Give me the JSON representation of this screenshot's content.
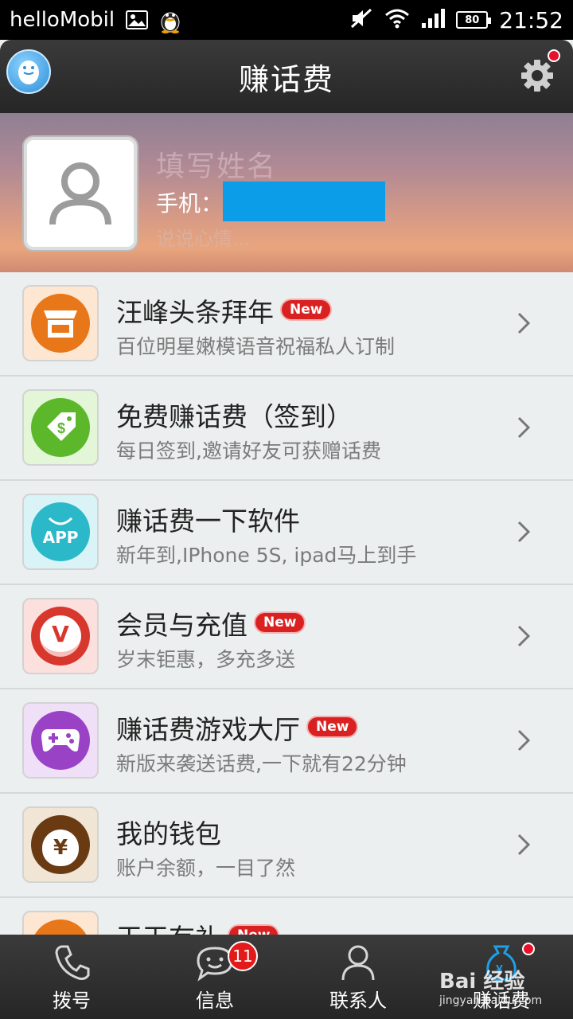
{
  "status_bar": {
    "carrier": "helloMobil",
    "battery": "80",
    "time": "21:52"
  },
  "header": {
    "title": "赚话费"
  },
  "profile": {
    "name_placeholder": "填写姓名",
    "phone_label": "手机：",
    "mood_placeholder": "说说心情..."
  },
  "menu": [
    {
      "title": "汪峰头条拜年",
      "subtitle": "百位明星嫩模语音祝福私人订制",
      "new": "New",
      "icon": "store-icon",
      "color": "#e8771a"
    },
    {
      "title": "免费赚话费（签到）",
      "subtitle": "每日签到,邀请好友可获赠话费",
      "new": "",
      "icon": "price-tag-icon",
      "color": "#5cb82a"
    },
    {
      "title": "赚话费一下软件",
      "subtitle": "新年到,IPhone 5S, ipad马上到手",
      "new": "",
      "icon": "app-bag-icon",
      "color": "#2bb9c9",
      "icon_text": "APP"
    },
    {
      "title": "会员与充值",
      "subtitle": "岁末钜惠，多充多送",
      "new": "New",
      "icon": "vip-icon",
      "color": "#d8372d",
      "icon_text": "V"
    },
    {
      "title": "赚话费游戏大厅",
      "subtitle": "新版来袭送话费,一下就有22分钟",
      "new": "New",
      "icon": "gamepad-icon",
      "color": "#9a42c6"
    },
    {
      "title": "我的钱包",
      "subtitle": "账户余额，一目了然",
      "new": "",
      "icon": "money-bag-icon",
      "color": "#6a3b12",
      "icon_text": "¥"
    },
    {
      "title": "天天有礼",
      "subtitle": "",
      "new": "New",
      "icon": "gift-icon",
      "color": "#e8771a"
    }
  ],
  "bottom_nav": {
    "tabs": [
      {
        "label": "拨号",
        "icon": "phone-icon"
      },
      {
        "label": "信息",
        "icon": "chat-icon",
        "badge": "11"
      },
      {
        "label": "联系人",
        "icon": "contact-icon"
      },
      {
        "label": "赚话费",
        "icon": "money-pouch-icon"
      }
    ]
  },
  "watermark": {
    "line1": "Bai 经验",
    "line2": "jingyan.baidu.com"
  },
  "colors": {
    "header_bg": "#2e2e2e",
    "accent_blue": "#0b9de8",
    "badge_red": "#d92121"
  }
}
